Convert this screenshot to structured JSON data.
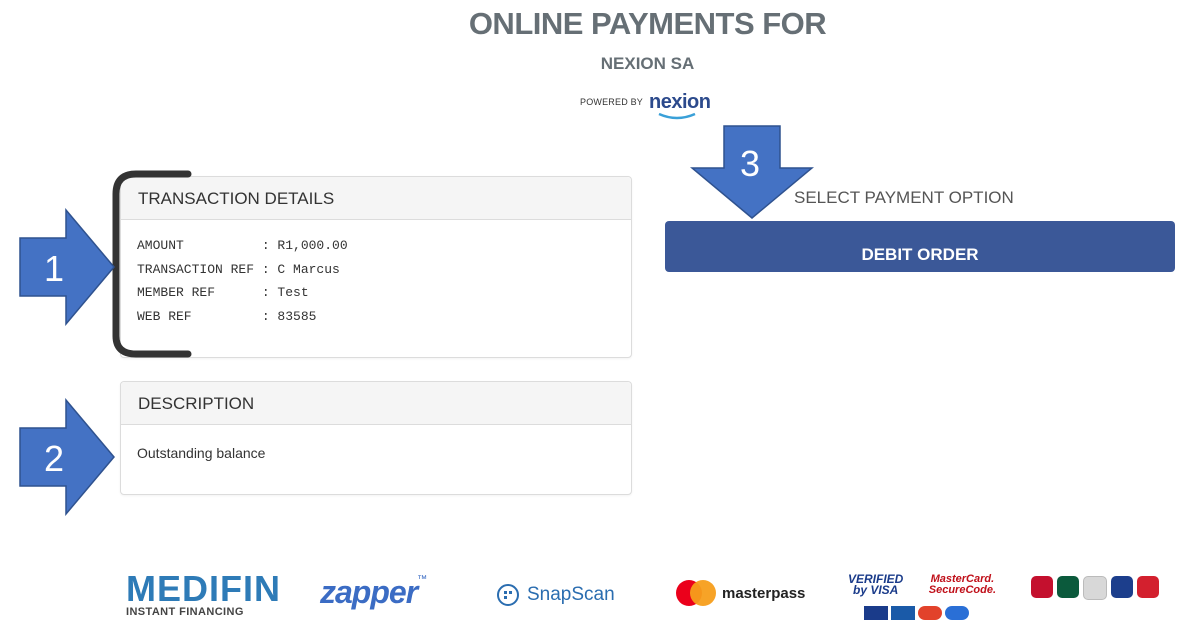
{
  "header": {
    "title": "ONLINE PAYMENTS FOR",
    "merchant": "NEXION SA",
    "powered_by": "POWERED BY",
    "logo_text": "nexion"
  },
  "transaction": {
    "heading": "TRANSACTION DETAILS",
    "rows": [
      {
        "label": "AMOUNT",
        "value": "R1,000.00"
      },
      {
        "label": "TRANSACTION REF",
        "value": "C Marcus"
      },
      {
        "label": "MEMBER REF",
        "value": "Test"
      },
      {
        "label": "WEB REF",
        "value": "83585"
      }
    ],
    "row_lines": [
      "AMOUNT          : R1,000.00",
      "TRANSACTION REF : C Marcus",
      "MEMBER REF      : Test",
      "WEB REF         : 83585"
    ]
  },
  "description": {
    "heading": "DESCRIPTION",
    "text": "Outstanding balance"
  },
  "payment": {
    "select_label": "SELECT PAYMENT OPTION",
    "debit_order_label": "DEBIT ORDER"
  },
  "callouts": {
    "one": "1",
    "two": "2",
    "three": "3",
    "color": "#4472c4",
    "bracket_color": "#333333"
  },
  "footer_logos": {
    "medifin": "MEDIFIN",
    "medifin_tagline": "INSTANT FINANCING",
    "zapper": "zapper",
    "zapper_tm": "™",
    "snapscan": "SnapScan",
    "masterpass": "masterpass",
    "verified_by_visa_line1": "VERIFIED",
    "verified_by_visa_line2": "by VISA",
    "mastercard_securecode_line1": "MasterCard.",
    "mastercard_securecode_line2": "SecureCode."
  },
  "colors": {
    "button": "#3b5898",
    "title": "#666f75",
    "panel_header_bg": "#f5f5f5"
  }
}
